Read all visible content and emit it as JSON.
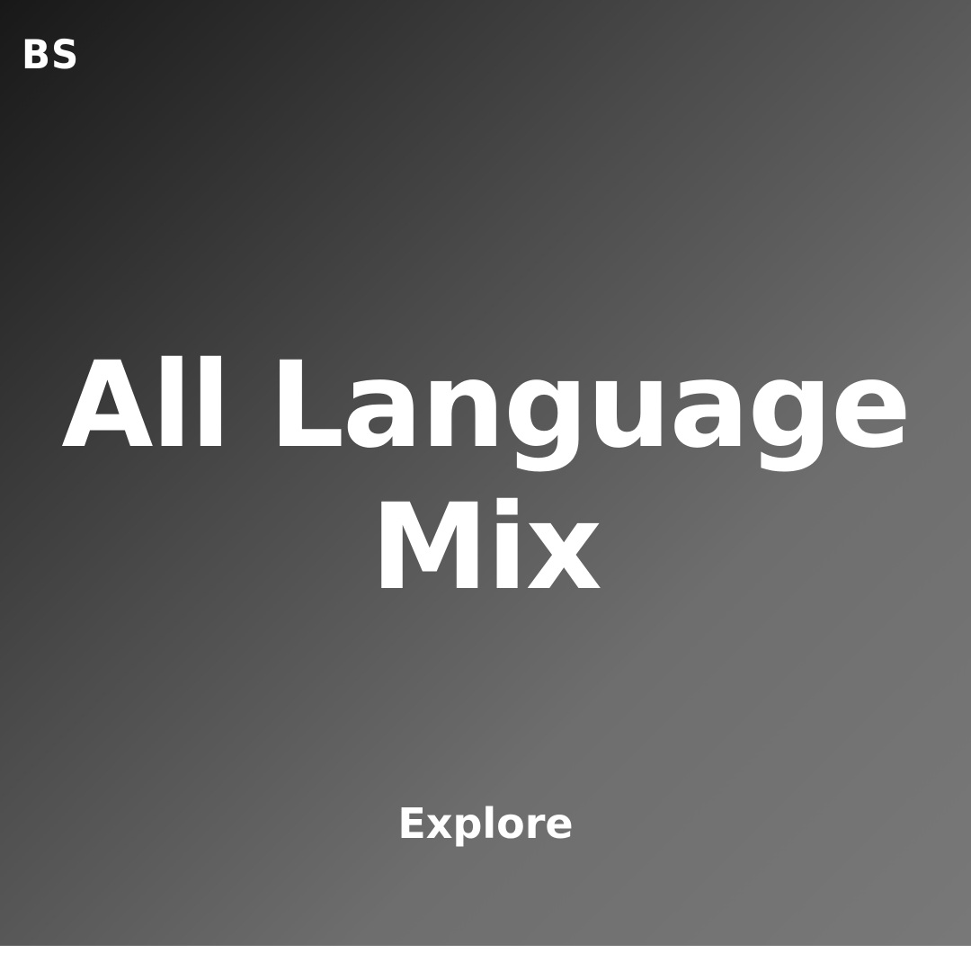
{
  "brand": {
    "logo_text": "BS"
  },
  "playlist": {
    "title_line_1": "All Language",
    "title_line_2": "Mix",
    "action_label": "Explore"
  },
  "colors": {
    "gradient_dark": "#181818",
    "gradient_light": "#787878",
    "text": "#ffffff"
  }
}
